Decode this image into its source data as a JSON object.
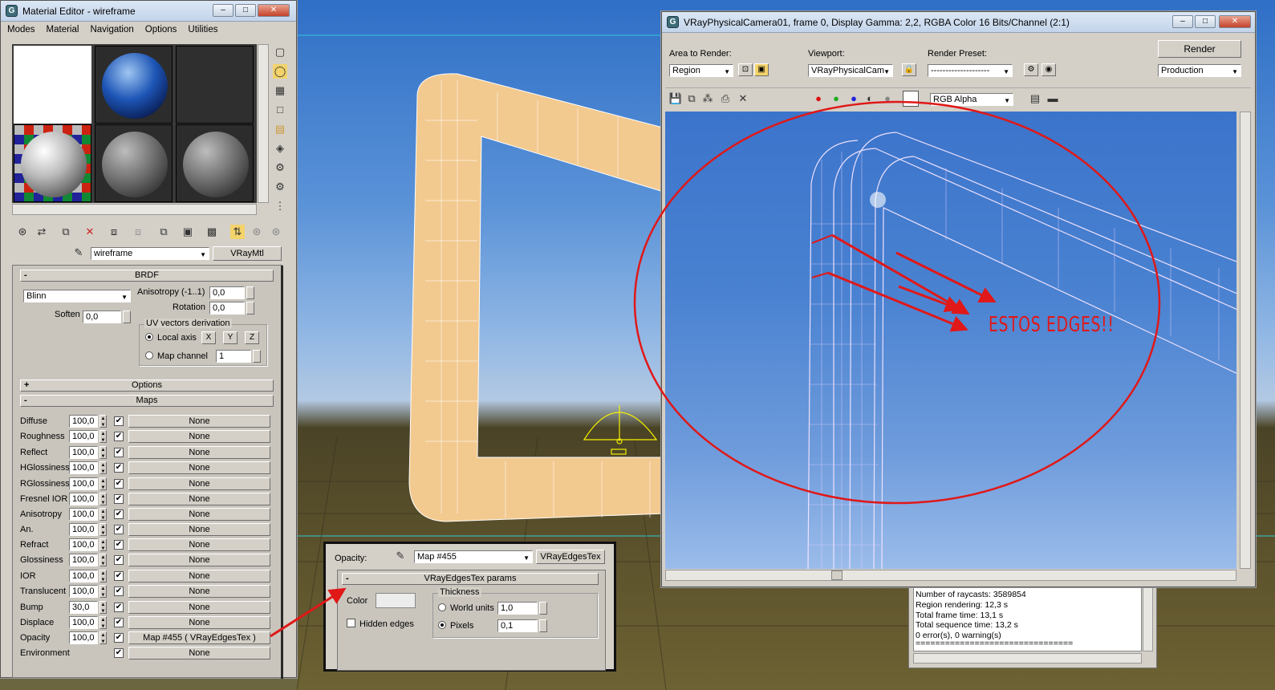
{
  "material_editor": {
    "title": "Material Editor - wireframe",
    "menu": [
      "Modes",
      "Material",
      "Navigation",
      "Options",
      "Utilities"
    ],
    "material_name": "wireframe",
    "material_type": "VRayMtl",
    "brdf": {
      "header": "BRDF",
      "type": "Blinn",
      "anisotropy_label": "Anisotropy (-1..1)",
      "anisotropy_value": "0,0",
      "rotation_label": "Rotation",
      "rotation_value": "0,0",
      "soften_label": "Soften",
      "soften_value": "0,0",
      "uv_group": "UV vectors derivation",
      "local_axis": "Local axis",
      "axis_x": "X",
      "axis_y": "Y",
      "axis_z": "Z",
      "map_channel": "Map channel",
      "map_channel_value": "1"
    },
    "options_header": "Options",
    "maps_header": "Maps",
    "maps": [
      {
        "label": "Diffuse",
        "value": "100,0",
        "map": "None"
      },
      {
        "label": "Roughness",
        "value": "100,0",
        "map": "None"
      },
      {
        "label": "Reflect",
        "value": "100,0",
        "map": "None"
      },
      {
        "label": "HGlossiness",
        "value": "100,0",
        "map": "None"
      },
      {
        "label": "RGlossiness",
        "value": "100,0",
        "map": "None"
      },
      {
        "label": "Fresnel IOR",
        "value": "100,0",
        "map": "None"
      },
      {
        "label": "Anisotropy",
        "value": "100,0",
        "map": "None"
      },
      {
        "label": "An.",
        "value": "100,0",
        "map": "None"
      },
      {
        "label": "Refract",
        "value": "100,0",
        "map": "None"
      },
      {
        "label": "Glossiness",
        "value": "100,0",
        "map": "None"
      },
      {
        "label": "IOR",
        "value": "100,0",
        "map": "None"
      },
      {
        "label": "Translucent",
        "value": "100,0",
        "map": "None"
      },
      {
        "label": "Bump",
        "value": "30,0",
        "map": "None"
      },
      {
        "label": "Displace",
        "value": "100,0",
        "map": "None"
      },
      {
        "label": "Opacity",
        "value": "100,0",
        "map": "Map #455  ( VRayEdgesTex )"
      },
      {
        "label": "Environment",
        "value": "",
        "map": "None"
      }
    ]
  },
  "edges_panel": {
    "opacity_label": "Opacity:",
    "map_name": "Map #455",
    "map_type": "VRayEdgesTex",
    "params_header": "VRayEdgesTex params",
    "color_label": "Color",
    "hidden_edges": "Hidden edges",
    "thickness": "Thickness",
    "world_units": "World units",
    "world_units_value": "1,0",
    "pixels": "Pixels",
    "pixels_value": "0,1"
  },
  "frame_buffer": {
    "title": "VRayPhysicalCamera01, frame 0, Display Gamma: 2,2, RGBA Color 16 Bits/Channel (2:1)",
    "area_label": "Area to Render:",
    "area_value": "Region",
    "viewport_label": "Viewport:",
    "viewport_value": "VRayPhysicalCam",
    "preset_label": "Render Preset:",
    "preset_value": "--------------------",
    "render_button": "Render",
    "render_mode": "Production",
    "channel": "RGB Alpha",
    "annotation": "ESTOS EDGES!!"
  },
  "log": [
    "Number of raycasts: 3589854",
    "Region rendering: 12,3 s",
    "Total frame time: 13,1 s",
    "Total sequence time: 13,2 s",
    "0 error(s), 0 warning(s)",
    "================================"
  ],
  "colors": {
    "annotation": "#e01818",
    "wire_tube": "#f2c98f"
  }
}
